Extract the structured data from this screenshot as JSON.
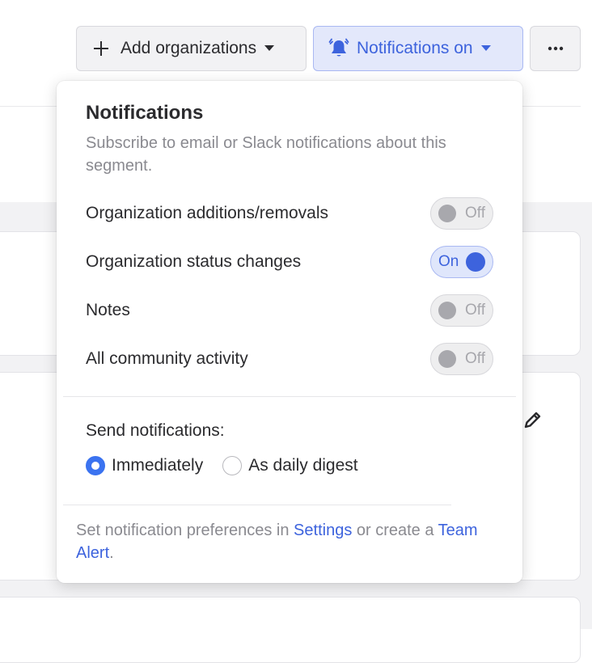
{
  "toolbar": {
    "add_label": "Add organizations",
    "notifications_label": "Notifications on"
  },
  "popover": {
    "title": "Notifications",
    "subtitle": "Subscribe to email or Slack notifications about this segment.",
    "settings": [
      {
        "label": "Organization additions/removals",
        "state": "Off"
      },
      {
        "label": "Organization status changes",
        "state": "On"
      },
      {
        "label": "Notes",
        "state": "Off"
      },
      {
        "label": "All community activity",
        "state": "Off"
      }
    ],
    "send_label": "Send notifications:",
    "send_options": [
      {
        "label": "Immediately",
        "selected": true
      },
      {
        "label": "As daily digest",
        "selected": false
      }
    ],
    "footer": {
      "text_before": "Set notification preferences in ",
      "settings_link": "Settings",
      "text_middle": " or create a ",
      "team_alert_link": "Team Alert",
      "text_after": "."
    }
  },
  "colors": {
    "accent": "#3d63dd",
    "accent_bg": "#e3e8fb",
    "radio_checked": "#3b73f0"
  },
  "icons": {
    "add": "plus-icon",
    "notifications": "bell-icon",
    "more": "ellipsis-icon",
    "edit": "pencil-icon"
  }
}
